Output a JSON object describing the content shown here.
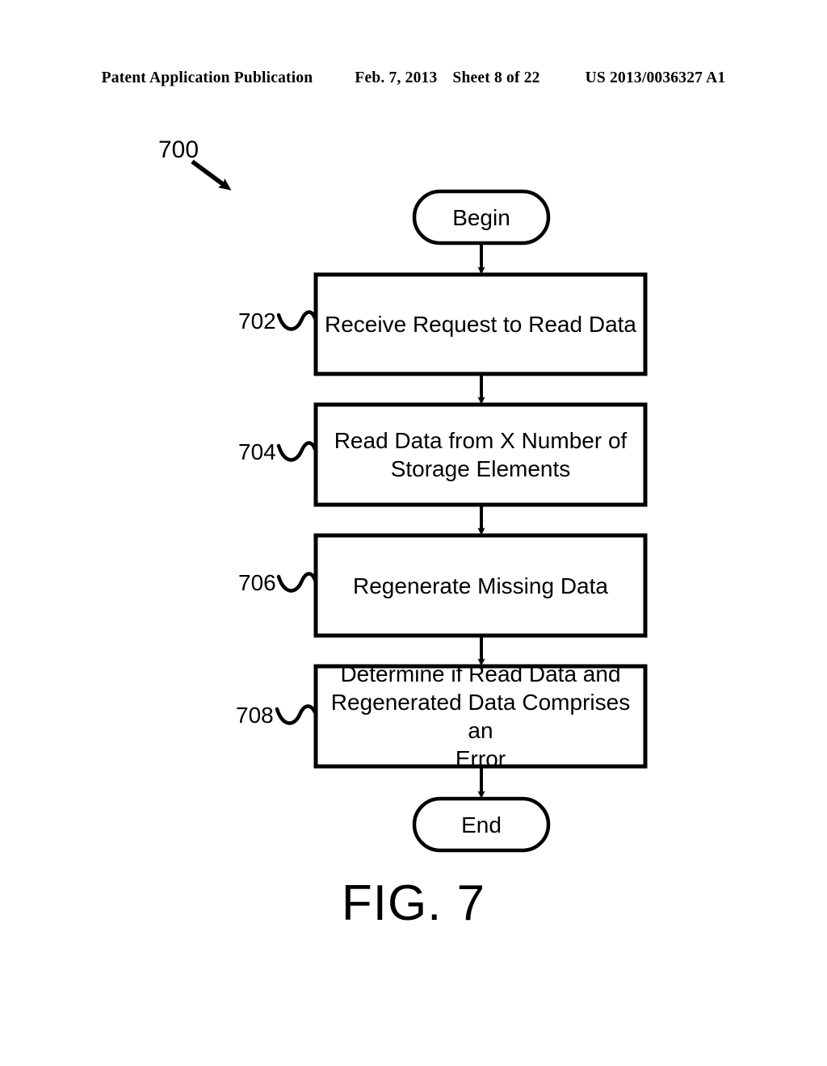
{
  "header": {
    "publication": "Patent Application Publication",
    "date": "Feb. 7, 2013",
    "sheet": "Sheet 8 of 22",
    "pub_number": "US 2013/0036327 A1"
  },
  "figure": {
    "caption": "FIG. 7",
    "flowchart_ref": "700",
    "line_color": "#000000",
    "fill_color": "#ffffff",
    "nodes": [
      {
        "id": "begin",
        "type": "terminator",
        "label": "Begin"
      },
      {
        "id": "702",
        "type": "process",
        "ref": "702",
        "label": "Receive Request to Read Data"
      },
      {
        "id": "704",
        "type": "process",
        "ref": "704",
        "label": "Read Data from X Number of\nStorage Elements"
      },
      {
        "id": "706",
        "type": "process",
        "ref": "706",
        "label": "Regenerate Missing Data"
      },
      {
        "id": "708",
        "type": "process",
        "ref": "708",
        "label": "Determine if Read Data and\nRegenerated Data Comprises an\nError"
      },
      {
        "id": "end",
        "type": "terminator",
        "label": "End"
      }
    ],
    "edges": [
      {
        "from": "begin",
        "to": "702"
      },
      {
        "from": "702",
        "to": "704"
      },
      {
        "from": "704",
        "to": "706"
      },
      {
        "from": "706",
        "to": "708"
      },
      {
        "from": "708",
        "to": "end"
      }
    ]
  }
}
